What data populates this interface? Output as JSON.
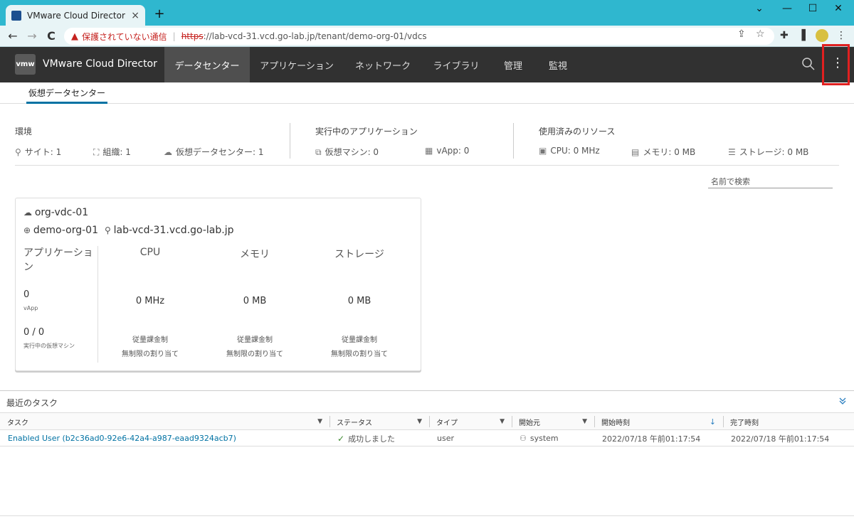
{
  "browser": {
    "tab_title": "VMware Cloud Director - 仮想デ",
    "tab_close": "×",
    "new_tab": "+",
    "window_controls": [
      "⌄",
      "—",
      "☐",
      "✕"
    ],
    "back": "←",
    "forward": "→",
    "reload": "C",
    "not_secure": "保護されていない通信",
    "url_scheme": "https",
    "url_rest": "://lab-vcd-31.vcd.go-lab.jp/tenant/demo-org-01/vdcs"
  },
  "header": {
    "logo": "vmw",
    "brand": "VMware Cloud Director",
    "nav": [
      "データセンター",
      "アプリケーション",
      "ネットワーク",
      "ライブラリ",
      "管理",
      "監視"
    ],
    "more": "⋮"
  },
  "subtab": "仮想データセンター",
  "summary": {
    "environment": {
      "title": "環境",
      "sites": "サイト: 1",
      "orgs": "組織: 1",
      "vdcs": "仮想データセンター: 1"
    },
    "running_apps": {
      "title": "実行中のアプリケーション",
      "vms": "仮想マシン: 0",
      "vapps": "vApp: 0"
    },
    "used_resources": {
      "title": "使用済みのリソース",
      "cpu": "CPU: 0 MHz",
      "memory": "メモリ: 0 MB",
      "storage": "ストレージ: 0 MB"
    }
  },
  "search_placeholder": "名前で検索",
  "card": {
    "name": "org-vdc-01",
    "org": "demo-org-01",
    "site": "lab-vcd-31.vcd.go-lab.jp",
    "apps_label": "アプリケーション",
    "vapp_count": "0",
    "vapp_label": "vApp",
    "vm_count": "0 / 0",
    "vm_label": "実行中の仮想マシン",
    "resources": [
      {
        "head": "CPU",
        "value": "0 MHz",
        "model": "従量課金制",
        "alloc": "無制限の割り当て"
      },
      {
        "head": "メモリ",
        "value": "0 MB",
        "model": "従量課金制",
        "alloc": "無制限の割り当て"
      },
      {
        "head": "ストレージ",
        "value": "0 MB",
        "model": "従量課金制",
        "alloc": "無制限の割り当て"
      }
    ]
  },
  "tasks": {
    "title": "最近のタスク",
    "columns": [
      "タスク",
      "ステータス",
      "タイプ",
      "開始元",
      "開始時刻",
      "完了時刻"
    ],
    "rows": [
      {
        "task": "Enabled User (b2c36ad0-92e6-42a4-a987-eaad9324acb7)",
        "status": "成功しました",
        "type": "user",
        "initiator": "system",
        "start": "2022/07/18 午前01:17:54",
        "end": "2022/07/18 午前01:17:54"
      }
    ]
  }
}
